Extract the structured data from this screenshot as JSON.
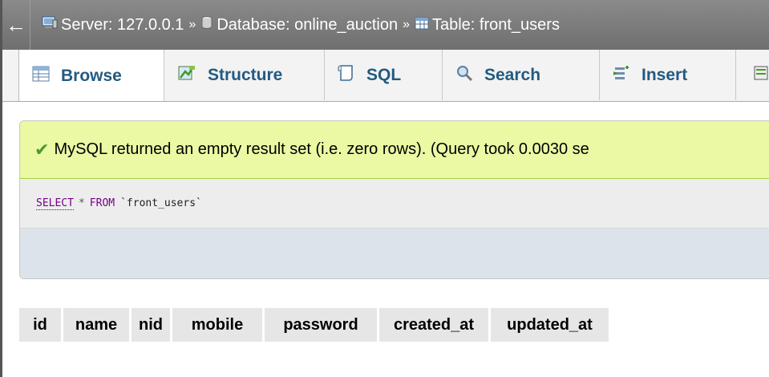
{
  "breadcrumb": {
    "back_glyph": "←",
    "server": "Server: 127.0.0.1",
    "separator": "»",
    "database": "Database: online_auction",
    "table": "Table: front_users"
  },
  "tabs": [
    {
      "label": "Browse",
      "icon": "browse-icon",
      "active": true
    },
    {
      "label": "Structure",
      "icon": "structure-icon",
      "active": false
    },
    {
      "label": "SQL",
      "icon": "sql-icon",
      "active": false
    },
    {
      "label": "Search",
      "icon": "search-icon",
      "active": false
    },
    {
      "label": "Insert",
      "icon": "insert-icon",
      "active": false
    }
  ],
  "message": {
    "text": "MySQL returned an empty result set (i.e. zero rows). (Query took 0.0030 se"
  },
  "query": {
    "select": "SELECT",
    "star": "*",
    "from": "FROM",
    "table": "`front_users`"
  },
  "columns": [
    "id",
    "name",
    "nid",
    "mobile",
    "password",
    "created_at",
    "updated_at"
  ],
  "colors": {
    "accent": "#235a81",
    "success_bg": "#ebf8a4",
    "topbar": "#7b7b7b"
  }
}
